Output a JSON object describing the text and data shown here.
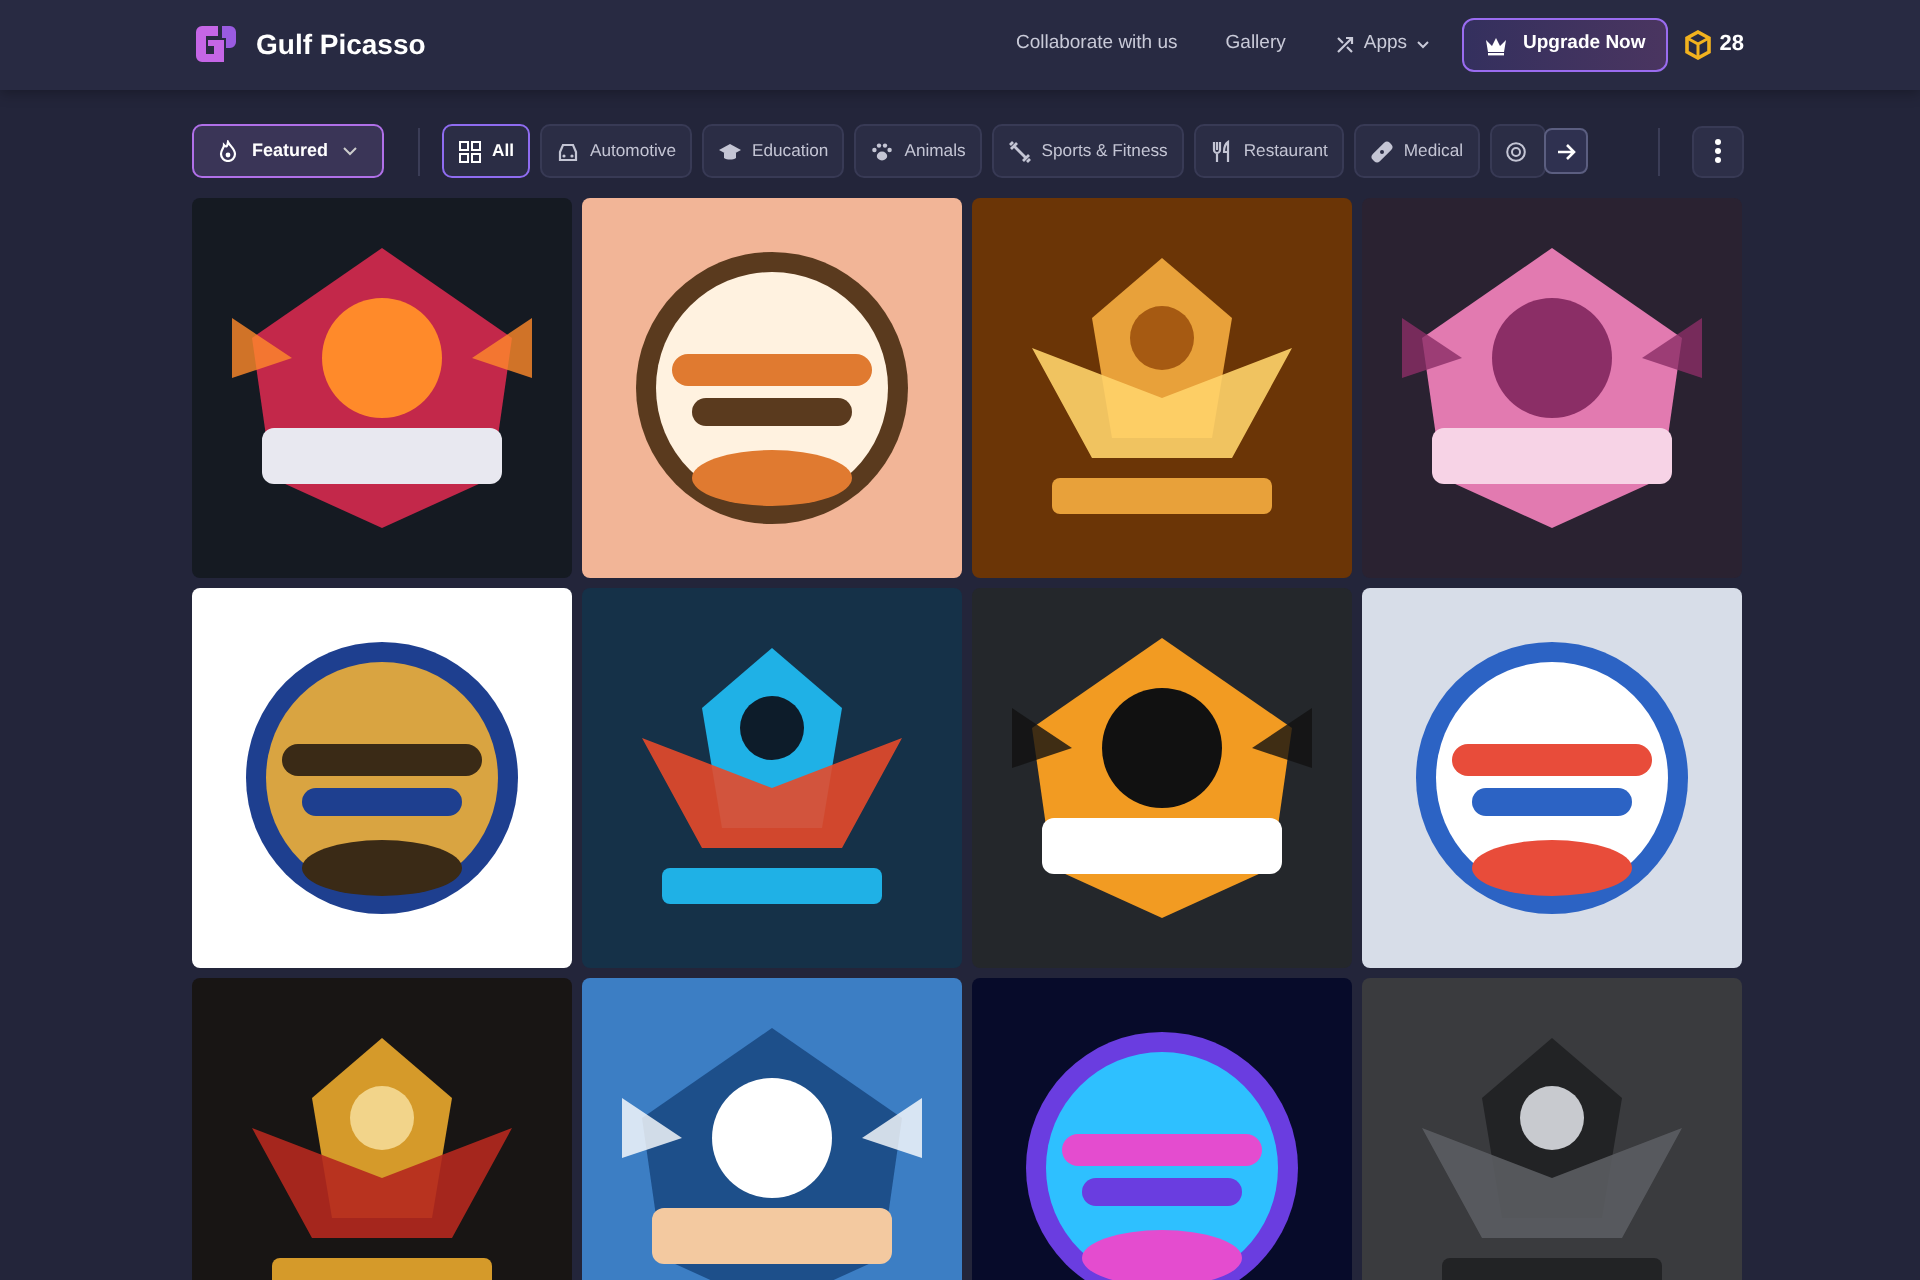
{
  "header": {
    "brand": "Gulf Picasso",
    "nav": [
      {
        "label": "Collaborate with us",
        "kind": "link"
      },
      {
        "label": "Gallery",
        "kind": "link"
      },
      {
        "label": "Apps",
        "kind": "dropdown"
      }
    ],
    "upgrade_button": "Upgrade Now",
    "credits": "28"
  },
  "filters": {
    "sort": {
      "label": "Featured"
    },
    "categories": [
      {
        "label": "All",
        "selected": true
      },
      {
        "label": "Automotive",
        "selected": false
      },
      {
        "label": "Education",
        "selected": false
      },
      {
        "label": "Animals",
        "selected": false
      },
      {
        "label": "Sports & Fitness",
        "selected": false
      },
      {
        "label": "Restaurant",
        "selected": false
      },
      {
        "label": "Medical",
        "selected": false
      }
    ]
  }
}
